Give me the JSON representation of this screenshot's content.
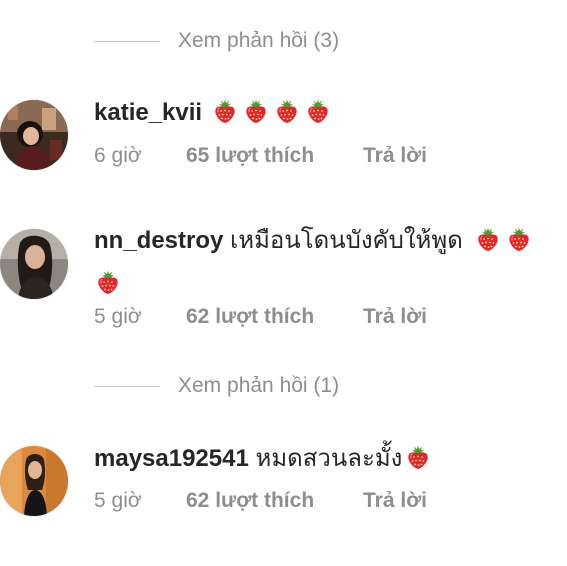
{
  "view_replies_top": {
    "label": "Xem phản hồi (3)"
  },
  "comments": [
    {
      "username": "katie_kvii",
      "text": "",
      "emoji": "strawberry-emoji",
      "emoji_count": 4,
      "time": "6 giờ",
      "likes": "65 lượt thích",
      "reply": "Trả lời"
    },
    {
      "username": "nn_destroy",
      "text": "เหมือนโดนบังคับให้พูด",
      "emoji": "strawberry-emoji",
      "emoji_count": 3,
      "time": "5 giờ",
      "likes": "62 lượt thích",
      "reply": "Trả lời"
    },
    {
      "username": "maysa192541",
      "text": "หมดสวนละมั้ง",
      "emoji": "strawberry-emoji",
      "emoji_count": 1,
      "time": "5 giờ",
      "likes": "62 lượt thích",
      "reply": "Trả lời"
    }
  ],
  "view_replies_bottom": {
    "label": "Xem phản hồi (1)"
  },
  "colors": {
    "text_primary": "#262626",
    "text_secondary": "#8e8e8e",
    "divider": "#c7c7c7",
    "strawberry_red": "#e0262e",
    "strawberry_leaf": "#4f9a2c"
  }
}
